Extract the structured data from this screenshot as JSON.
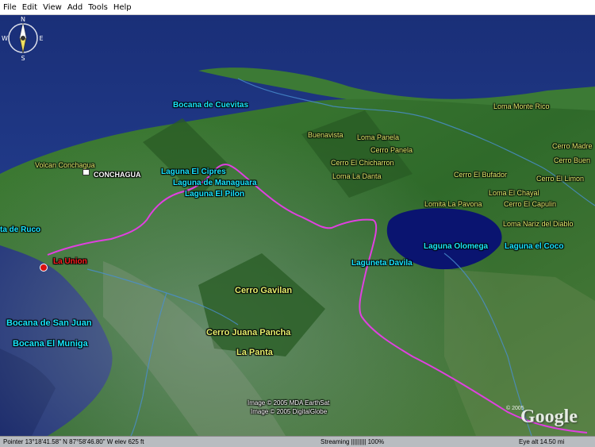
{
  "menu": [
    "File",
    "Edit",
    "View",
    "Add",
    "Tools",
    "Help"
  ],
  "labels": {
    "bocana_cuevitas": "Bocana de Cuevitas",
    "loma_monte_rico": "Loma Monte Rico",
    "buenavista": "Buenavista",
    "loma_panela": "Loma Panela",
    "cerro_panela": "Cerro Panela",
    "cerro_chicharron": "Cerro El Chicharron",
    "cerro_madre": "Cerro Madre",
    "cerro_buen": "Cerro Buen",
    "volcan_conchagua": "Volcan Conchagua",
    "conchagua": "CONCHAGUA",
    "laguna_cipres": "Laguna El Cipres",
    "laguna_managuara": "Laguna de Managuara",
    "laguna_pilon": "Laguna El Pilon",
    "loma_la_danta": "Loma La Danta",
    "cerro_bufador": "Cerro El Bufador",
    "cerro_limon": "Cerro El Limon",
    "loma_chayal": "Loma El Chayal",
    "lomita_pavona": "Lomita La Pavona",
    "cerro_capulin": "Cerro El Capulin",
    "loma_nariz": "Loma Nariz del Diablo",
    "ruco": "ta de Ruco",
    "la_union": "La Union",
    "laguna_olomega": "Laguna Olomega",
    "laguna_coco": "Laguna el Coco",
    "laguneta_davila": "Laguneta Davila",
    "cerro_gavilan": "Cerro Gavilan",
    "bocana_san_juan": "Bocana de San Juan",
    "bocana_muniga": "Bocana El Muniga",
    "cerro_juana_pancha": "Cerro Juana Pancha",
    "la_panta": "La Panta",
    "copyright1": "Image © 2005 MDA EarthSat",
    "copyright2": "Image © 2005 DigitalGlobe",
    "google_small": "© 2005",
    "google": "Google"
  },
  "compass": {
    "n": "N",
    "s": "S",
    "e": "E",
    "w": "W"
  },
  "status": {
    "pointer": "Pointer  13°18'41.58\" N  87°58'46.80\" W  elev  625 ft",
    "streaming": "Streaming ||||||||| 100%",
    "eye": "Eye  alt   14.50 mi"
  },
  "colors": {
    "sea": "#1b3a8a",
    "land": "#2d6b2a",
    "road": "#e040e0",
    "label_cyan": "#18e6ff",
    "label_yellow": "#e6f06e"
  }
}
